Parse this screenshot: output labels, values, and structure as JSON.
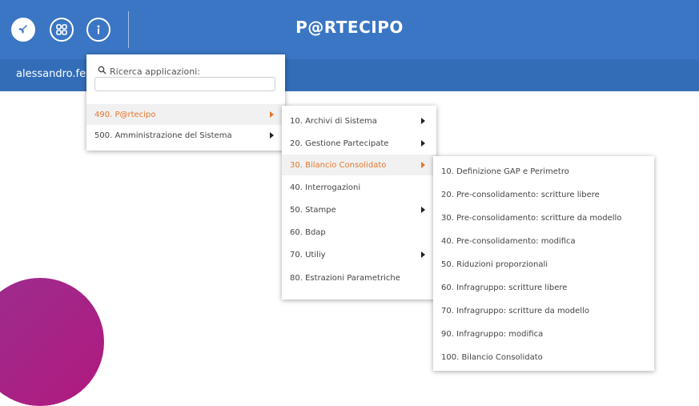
{
  "header": {
    "title": "P@RTECIPO",
    "icons": [
      "rocket-icon",
      "grid-icon",
      "info-icon"
    ]
  },
  "user": {
    "name": "alessandro.fe"
  },
  "menu_main": {
    "search_label": "Ricerca applicazioni:",
    "search_value": "",
    "items": [
      {
        "label": "490. P@rtecipo",
        "active": true,
        "submenu": true
      },
      {
        "label": "500. Amministrazione del Sistema",
        "active": false,
        "submenu": true
      }
    ]
  },
  "menu_partecipo": {
    "items": [
      {
        "label": "10. Archivi di Sistema",
        "submenu": true
      },
      {
        "label": "20. Gestione Partecipate",
        "submenu": true
      },
      {
        "label": "30. Bilancio Consolidato",
        "submenu": true,
        "active": true
      },
      {
        "label": "40. Interrogazioni",
        "submenu": false
      },
      {
        "label": "50. Stampe",
        "submenu": true
      },
      {
        "label": "60. Bdap",
        "submenu": false
      },
      {
        "label": "70. Utiliy",
        "submenu": true
      },
      {
        "label": "80. Estrazioni Parametriche",
        "submenu": false
      }
    ]
  },
  "menu_bilancio": {
    "items": [
      {
        "label": "10. Definizione GAP e Perimetro"
      },
      {
        "label": "20. Pre-consolidamento: scritture libere"
      },
      {
        "label": "30. Pre-consolidamento: scritture da modello"
      },
      {
        "label": "40. Pre-consolidamento: modifica"
      },
      {
        "label": "50. Riduzioni proporzionali"
      },
      {
        "label": "60. Infragruppo: scritture libere"
      },
      {
        "label": "70. Infragruppo: scritture da modello"
      },
      {
        "label": "90. Infragruppo: modifica"
      },
      {
        "label": "100. Bilancio Consolidato"
      }
    ]
  },
  "colors": {
    "header_bg": "#3b76c4",
    "subbar_bg": "#336db8",
    "active_text": "#e8772e",
    "decor_circle": "#a8238a"
  }
}
